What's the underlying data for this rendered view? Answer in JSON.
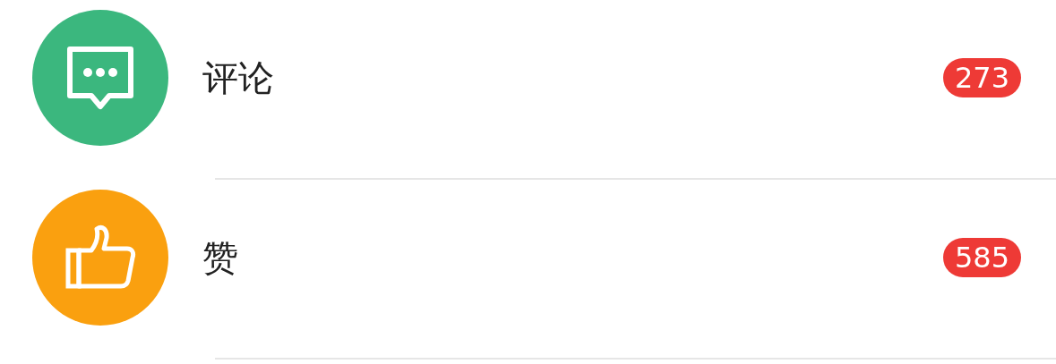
{
  "items": [
    {
      "kind": "comment",
      "color": "#3bb77e",
      "label": "评论",
      "count": "273"
    },
    {
      "kind": "like",
      "color": "#faa00f",
      "label": "赞",
      "count": "585"
    }
  ]
}
